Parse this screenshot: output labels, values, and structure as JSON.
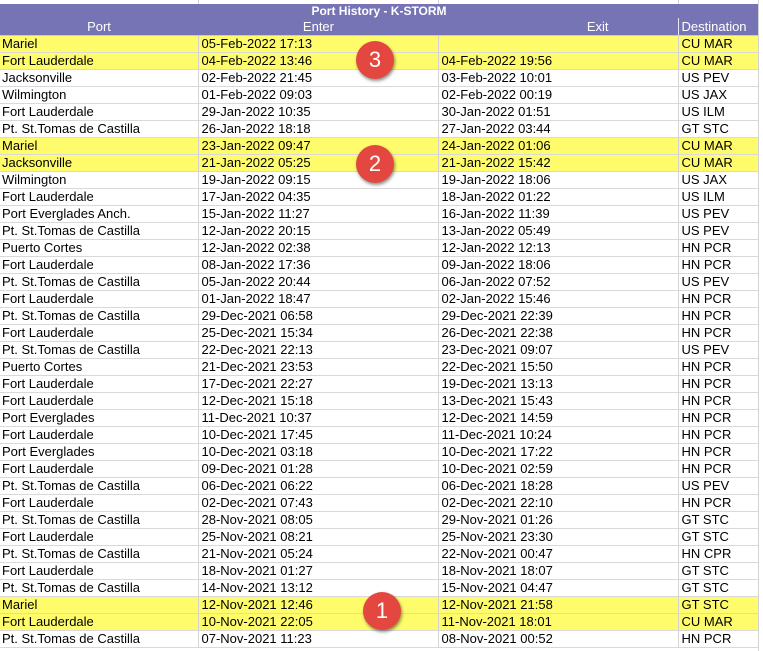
{
  "sheet": {
    "title": "Port History - K-STORM",
    "columns": [
      "Port",
      "Enter",
      "Exit",
      "Destination"
    ],
    "highlight_color": "#fffc6b",
    "header_color": "#7674b4",
    "badge_color": "#e3473f",
    "rows": [
      {
        "port": "Mariel",
        "enter": "05-Feb-2022 17:13",
        "exit": "",
        "dest": "CU MAR",
        "hl": true
      },
      {
        "port": "Fort Lauderdale",
        "enter": "04-Feb-2022 13:46",
        "exit": "04-Feb-2022 19:56",
        "dest": "CU MAR",
        "hl": true
      },
      {
        "port": "Jacksonville",
        "enter": "02-Feb-2022 21:45",
        "exit": "03-Feb-2022 10:01",
        "dest": "US PEV",
        "hl": false
      },
      {
        "port": "Wilmington",
        "enter": "01-Feb-2022 09:03",
        "exit": "02-Feb-2022 00:19",
        "dest": "US JAX",
        "hl": false
      },
      {
        "port": "Fort Lauderdale",
        "enter": "29-Jan-2022 10:35",
        "exit": "30-Jan-2022 01:51",
        "dest": "US ILM",
        "hl": false
      },
      {
        "port": "Pt. St.Tomas de Castilla",
        "enter": "26-Jan-2022 18:18",
        "exit": "27-Jan-2022 03:44",
        "dest": "GT STC",
        "hl": false
      },
      {
        "port": "Mariel",
        "enter": "23-Jan-2022 09:47",
        "exit": "24-Jan-2022 01:06",
        "dest": "CU MAR",
        "hl": true
      },
      {
        "port": "Jacksonville",
        "enter": "21-Jan-2022 05:25",
        "exit": "21-Jan-2022 15:42",
        "dest": "CU MAR",
        "hl": true
      },
      {
        "port": "Wilmington",
        "enter": "19-Jan-2022 09:15",
        "exit": "19-Jan-2022 18:06",
        "dest": "US JAX",
        "hl": false
      },
      {
        "port": "Fort Lauderdale",
        "enter": "17-Jan-2022 04:35",
        "exit": "18-Jan-2022 01:22",
        "dest": "US ILM",
        "hl": false
      },
      {
        "port": "Port Everglades Anch.",
        "enter": "15-Jan-2022 11:27",
        "exit": "16-Jan-2022 11:39",
        "dest": "US PEV",
        "hl": false
      },
      {
        "port": "Pt. St.Tomas de Castilla",
        "enter": "12-Jan-2022 20:15",
        "exit": "13-Jan-2022 05:49",
        "dest": "US PEV",
        "hl": false
      },
      {
        "port": "Puerto Cortes",
        "enter": "12-Jan-2022 02:38",
        "exit": "12-Jan-2022 12:13",
        "dest": "HN PCR",
        "hl": false
      },
      {
        "port": "Fort Lauderdale",
        "enter": "08-Jan-2022 17:36",
        "exit": "09-Jan-2022 18:06",
        "dest": "HN PCR",
        "hl": false
      },
      {
        "port": "Pt. St.Tomas de Castilla",
        "enter": "05-Jan-2022 20:44",
        "exit": "06-Jan-2022 07:52",
        "dest": "US PEV",
        "hl": false
      },
      {
        "port": "Fort Lauderdale",
        "enter": "01-Jan-2022 18:47",
        "exit": "02-Jan-2022 15:46",
        "dest": "HN PCR",
        "hl": false
      },
      {
        "port": "Pt. St.Tomas de Castilla",
        "enter": "29-Dec-2021 06:58",
        "exit": "29-Dec-2021 22:39",
        "dest": "HN PCR",
        "hl": false
      },
      {
        "port": "Fort Lauderdale",
        "enter": "25-Dec-2021 15:34",
        "exit": "26-Dec-2021 22:38",
        "dest": "HN PCR",
        "hl": false
      },
      {
        "port": "Pt. St.Tomas de Castilla",
        "enter": "22-Dec-2021 22:13",
        "exit": "23-Dec-2021 09:07",
        "dest": "US PEV",
        "hl": false
      },
      {
        "port": "Puerto Cortes",
        "enter": "21-Dec-2021 23:53",
        "exit": "22-Dec-2021 15:50",
        "dest": "HN PCR",
        "hl": false
      },
      {
        "port": "Fort Lauderdale",
        "enter": "17-Dec-2021 22:27",
        "exit": "19-Dec-2021 13:13",
        "dest": "HN PCR",
        "hl": false
      },
      {
        "port": "Fort Lauderdale",
        "enter": "12-Dec-2021 15:18",
        "exit": "13-Dec-2021 15:43",
        "dest": "HN PCR",
        "hl": false
      },
      {
        "port": "Port Everglades",
        "enter": "11-Dec-2021 10:37",
        "exit": "12-Dec-2021 14:59",
        "dest": "HN PCR",
        "hl": false
      },
      {
        "port": "Fort Lauderdale",
        "enter": "10-Dec-2021 17:45",
        "exit": "11-Dec-2021 10:24",
        "dest": "HN PCR",
        "hl": false
      },
      {
        "port": "Port Everglades",
        "enter": "10-Dec-2021 03:18",
        "exit": "10-Dec-2021 17:22",
        "dest": "HN PCR",
        "hl": false
      },
      {
        "port": "Fort Lauderdale",
        "enter": "09-Dec-2021 01:28",
        "exit": "10-Dec-2021 02:59",
        "dest": "HN PCR",
        "hl": false
      },
      {
        "port": "Pt. St.Tomas de Castilla",
        "enter": "06-Dec-2021 06:22",
        "exit": "06-Dec-2021 18:28",
        "dest": "US PEV",
        "hl": false
      },
      {
        "port": "Fort Lauderdale",
        "enter": "02-Dec-2021 07:43",
        "exit": "02-Dec-2021 22:10",
        "dest": "HN PCR",
        "hl": false
      },
      {
        "port": "Pt. St.Tomas de Castilla",
        "enter": "28-Nov-2021 08:05",
        "exit": "29-Nov-2021 01:26",
        "dest": "GT STC",
        "hl": false
      },
      {
        "port": "Fort Lauderdale",
        "enter": "25-Nov-2021 08:21",
        "exit": "25-Nov-2021 23:30",
        "dest": "GT STC",
        "hl": false
      },
      {
        "port": "Pt. St.Tomas de Castilla",
        "enter": "21-Nov-2021 05:24",
        "exit": "22-Nov-2021 00:47",
        "dest": "HN CPR",
        "hl": false
      },
      {
        "port": "Fort Lauderdale",
        "enter": "18-Nov-2021 01:27",
        "exit": "18-Nov-2021 18:07",
        "dest": "GT STC",
        "hl": false
      },
      {
        "port": "Pt. St.Tomas de Castilla",
        "enter": "14-Nov-2021 13:12",
        "exit": "15-Nov-2021 04:47",
        "dest": "GT STC",
        "hl": false
      },
      {
        "port": "Mariel",
        "enter": "12-Nov-2021 12:46",
        "exit": "12-Nov-2021 21:58",
        "dest": "GT STC",
        "hl": true
      },
      {
        "port": "Fort Lauderdale",
        "enter": "10-Nov-2021 22:05",
        "exit": "11-Nov-2021 18:01",
        "dest": "CU MAR",
        "hl": true
      },
      {
        "port": "Pt. St.Tomas de Castilla",
        "enter": "07-Nov-2021 11:23",
        "exit": "08-Nov-2021 00:52",
        "dest": "HN PCR",
        "hl": false
      }
    ]
  },
  "badges": [
    "3",
    "2",
    "1"
  ]
}
